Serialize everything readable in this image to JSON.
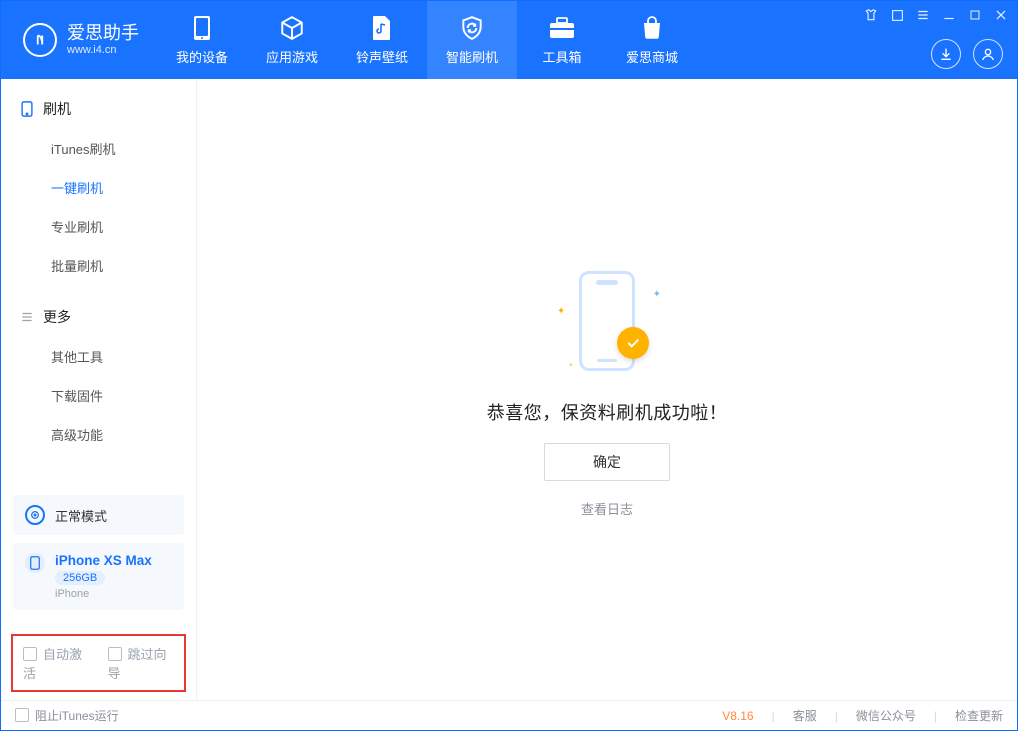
{
  "app": {
    "name": "爱思助手",
    "url": "www.i4.cn"
  },
  "nav": [
    {
      "label": "我的设备"
    },
    {
      "label": "应用游戏"
    },
    {
      "label": "铃声壁纸"
    },
    {
      "label": "智能刷机"
    },
    {
      "label": "工具箱"
    },
    {
      "label": "爱思商城"
    }
  ],
  "sidebar": {
    "group1": {
      "title": "刷机"
    },
    "items1": [
      {
        "label": "iTunes刷机"
      },
      {
        "label": "一键刷机"
      },
      {
        "label": "专业刷机"
      },
      {
        "label": "批量刷机"
      }
    ],
    "group2": {
      "title": "更多"
    },
    "items2": [
      {
        "label": "其他工具"
      },
      {
        "label": "下载固件"
      },
      {
        "label": "高级功能"
      }
    ]
  },
  "mode_card": {
    "label": "正常模式"
  },
  "device": {
    "name": "iPhone XS Max",
    "capacity": "256GB",
    "type": "iPhone"
  },
  "checkboxes": {
    "auto_activate": "自动激活",
    "skip_guide": "跳过向导"
  },
  "main": {
    "success_text": "恭喜您，保资料刷机成功啦！",
    "ok_button": "确定",
    "log_link": "查看日志"
  },
  "statusbar": {
    "block_itunes": "阻止iTunes运行",
    "version": "V8.16",
    "kf": "客服",
    "wx": "微信公众号",
    "update": "检查更新"
  }
}
